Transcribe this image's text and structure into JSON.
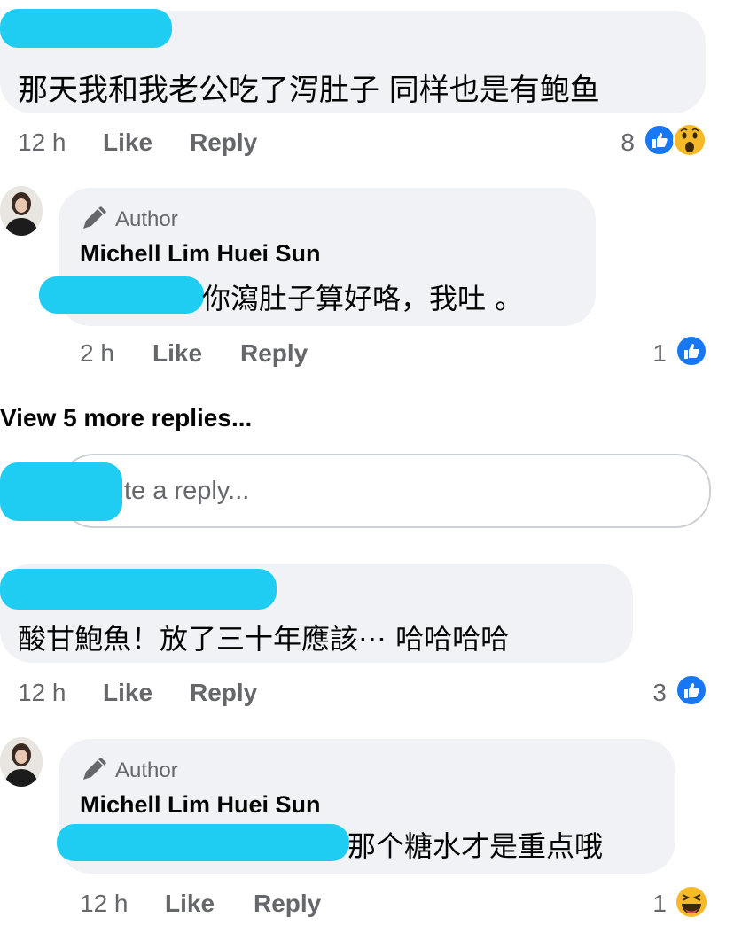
{
  "comments": [
    {
      "text": "那天我和我老公吃了泻肚子  同样也是有鲍鱼",
      "time": "12 h",
      "like": "Like",
      "reply": "Reply",
      "reaction_count": "8",
      "reactions": [
        "like-icon",
        "wow-icon"
      ],
      "replies": [
        {
          "badge": "Author",
          "author": "Michell Lim Huei Sun",
          "text": "你瀉肚子算好咯，我吐 。",
          "time": "2 h",
          "like": "Like",
          "reply": "Reply",
          "reaction_count": "1",
          "reactions": [
            "like-icon"
          ]
        }
      ],
      "view_more": "View 5 more replies...",
      "reply_placeholder": "te a reply..."
    },
    {
      "text": "酸甘鮑魚！放了三十年應該⋯ 哈哈哈哈",
      "time": "12 h",
      "like": "Like",
      "reply": "Reply",
      "reaction_count": "3",
      "reactions": [
        "like-icon"
      ],
      "replies": [
        {
          "badge": "Author",
          "author": "Michell Lim Huei Sun",
          "text": "那个糖水才是重点哦",
          "time": "12 h",
          "like": "Like",
          "reply": "Reply",
          "reaction_count": "1",
          "reactions": [
            "haha-icon"
          ]
        }
      ]
    }
  ],
  "colors": {
    "bubble": "#f0f2f5",
    "meta": "#65676b",
    "like_blue": "#1877f2",
    "redaction": "#1fcdf2"
  }
}
